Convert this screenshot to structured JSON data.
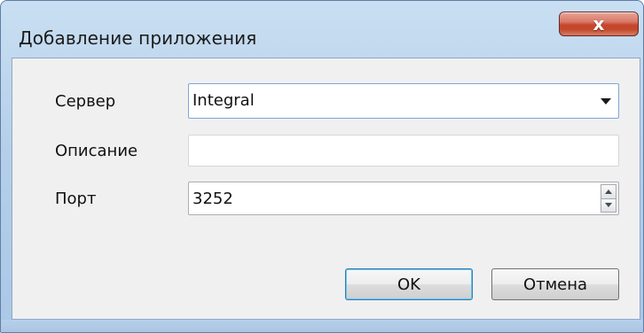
{
  "window": {
    "title": "Добавление приложения",
    "close_glyph": "x"
  },
  "form": {
    "server": {
      "label": "Сервер",
      "value": "Integral"
    },
    "description": {
      "label": "Описание",
      "value": ""
    },
    "port": {
      "label": "Порт",
      "value": "3252"
    }
  },
  "buttons": {
    "ok": "OK",
    "cancel": "Отмена"
  },
  "icons": {
    "close": "close-icon",
    "dropdown": "chevron-down-icon",
    "spin_up": "spin-up-icon",
    "spin_down": "spin-down-icon"
  },
  "colors": {
    "titlebar_glass": "#b5cfe9",
    "close_button": "#c8452b",
    "client_bg": "#f0f0f0",
    "focus_border": "#3d7bad"
  }
}
